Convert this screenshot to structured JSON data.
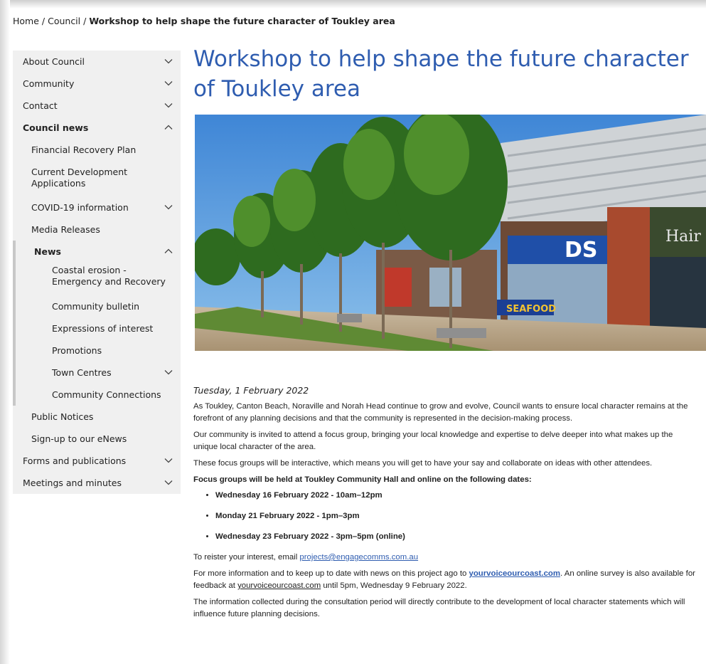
{
  "breadcrumb": {
    "home": "Home",
    "sep": " / ",
    "council": "Council",
    "current": "Workshop to help shape the future character of Toukley area"
  },
  "sidebar": {
    "about_council": "About Council",
    "community": "Community",
    "contact": "Contact",
    "council_news": "Council news",
    "financial_recovery": "Financial Recovery Plan",
    "current_development": "Current Development Applications",
    "covid": "COVID-19 information",
    "media_releases": "Media Releases",
    "news": "News",
    "coastal_erosion": "Coastal erosion - Emergency and Recovery",
    "community_bulletin": "Community bulletin",
    "expressions": "Expressions of interest",
    "promotions": "Promotions",
    "town_centres": "Town Centres",
    "community_connections": "Community Connections",
    "public_notices": "Public Notices",
    "signup": "Sign-up to our eNews",
    "forms": "Forms and publications",
    "meetings": "Meetings and minutes"
  },
  "article": {
    "title": "Workshop to help shape the future character of Toukley area",
    "hero_shop_sign": "DS",
    "hero_hair_sign": "Hair",
    "hero_seafood_sign": "SEAFOOD",
    "date": "Tuesday, 1 February 2022",
    "p1": "As Toukley, Canton Beach, Noraville and Norah Head continue to grow and evolve, Council wants to ensure local character remains at the forefront of any planning decisions and that the community is represented in the decision-making process.",
    "p2": "Our community is invited to attend a focus group, bringing your local knowledge and expertise to delve deeper into what makes up the unique local character of the area.",
    "p3": "These focus groups will be interactive, which means you will get to have your say and collaborate on ideas with other attendees.",
    "p4": "Focus groups will be held at Toukley Community Hall and online on the following dates:",
    "dates": [
      "Wednesday 16 February 2022 - 10am–12pm",
      "Monday 21 February 2022 - 1pm–3pm",
      "Wednesday 23 February 2022 - 3pm–5pm (online)"
    ],
    "register_text": "To reister your interest, email ",
    "register_email": "projects@engagecomms.com.au",
    "more_info_1": "For more information and to keep up to date with news on this project ago to ",
    "more_info_link": "yourvoiceourcoast.com",
    "more_info_2": ". An online survey is also available for feedback at ",
    "more_info_link2": "yourvoiceourcoast.com",
    "more_info_3": " until 5pm, Wednesday 9 February 2022.",
    "p_final": "The information collected during the consultation period will directly contribute to the development of local character statements which will influence future planning decisions."
  }
}
